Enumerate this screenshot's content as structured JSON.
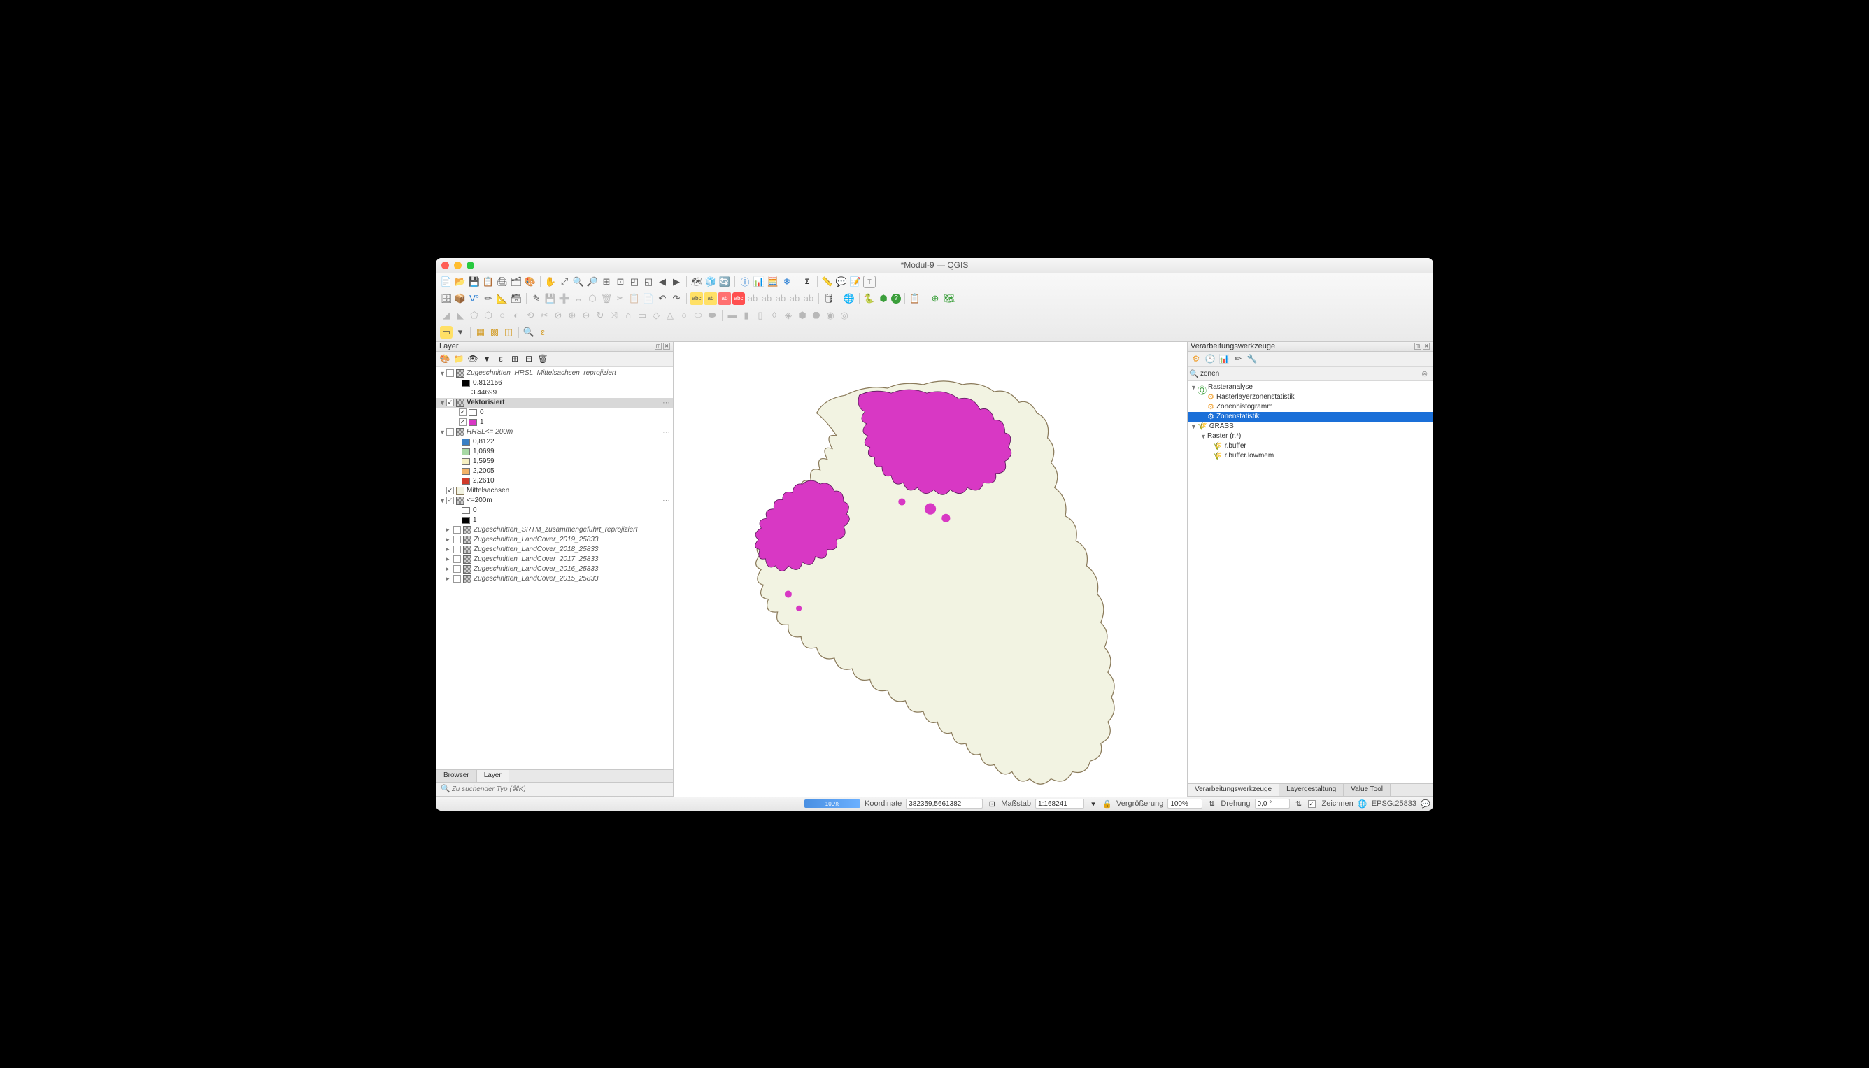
{
  "window": {
    "title": "*Modul-9 — QGIS"
  },
  "left_panel": {
    "title": "Layer",
    "tabs": [
      {
        "label": "Browser",
        "active": false
      },
      {
        "label": "Layer",
        "active": true
      }
    ],
    "search_placeholder": "Zu suchender Typ (⌘K)",
    "layers": {
      "hrsl_name": "Zugeschnitten_HRSL_Mittelsachsen_reprojiziert",
      "hrsl_v0": "0.812156",
      "hrsl_v1": "3.44699",
      "vekt_name": "Vektorisiert",
      "vekt_0": "0",
      "vekt_1": "1",
      "hrsl200_name": "HRSL<= 200m",
      "hrsl200_vals": [
        {
          "c": "#3a7fc4",
          "t": "0,8122"
        },
        {
          "c": "#a8d9a5",
          "t": "1,0699"
        },
        {
          "c": "#f6f0c2",
          "t": "1,5959"
        },
        {
          "c": "#f2b267",
          "t": "2,2005"
        },
        {
          "c": "#d13b2a",
          "t": "2,2610"
        }
      ],
      "mittel_name": "Mittelsachsen",
      "lte200_name": "<=200m",
      "lte200_vals": [
        {
          "c": "#ffffff",
          "t": "0"
        },
        {
          "c": "#000000",
          "t": "1"
        }
      ],
      "unchecked": [
        "Zugeschnitten_SRTM_zusammengeführt_reprojiziert",
        "Zugeschnitten_LandCover_2019_25833",
        "Zugeschnitten_LandCover_2018_25833",
        "Zugeschnitten_LandCover_2017_25833",
        "Zugeschnitten_LandCover_2016_25833",
        "Zugeschnitten_LandCover_2015_25833"
      ]
    }
  },
  "right_panel": {
    "title": "Verarbeitungswerkzeuge",
    "search_value": "zonen",
    "tree": {
      "rasteranalyse": "Rasteranalyse",
      "item1": "Rasterlayerzonenstatistik",
      "item2": "Zonenhistogramm",
      "item3": "Zonenstatistik",
      "grass": "GRASS",
      "raster_group": "Raster (r.*)",
      "buf1": "r.buffer",
      "buf2": "r.buffer.lowmem"
    },
    "tabs": [
      {
        "label": "Verarbeitungswerkzeuge",
        "active": true
      },
      {
        "label": "Layergestaltung",
        "active": false
      },
      {
        "label": "Value Tool",
        "active": false
      }
    ]
  },
  "status": {
    "progress": "100%",
    "coord_label": "Koordinate",
    "coord_value": "382359,5661382",
    "scale_label": "Maßstab",
    "scale_value": "1:168241",
    "mag_label": "Vergrößerung",
    "mag_value": "100%",
    "rot_label": "Drehung",
    "rot_value": "0,0 °",
    "render_label": "Zeichnen",
    "crs": "EPSG:25833"
  },
  "colors": {
    "magenta": "#d838c4",
    "land": "#f2f3e2",
    "boundary": "#8a7a5a"
  }
}
